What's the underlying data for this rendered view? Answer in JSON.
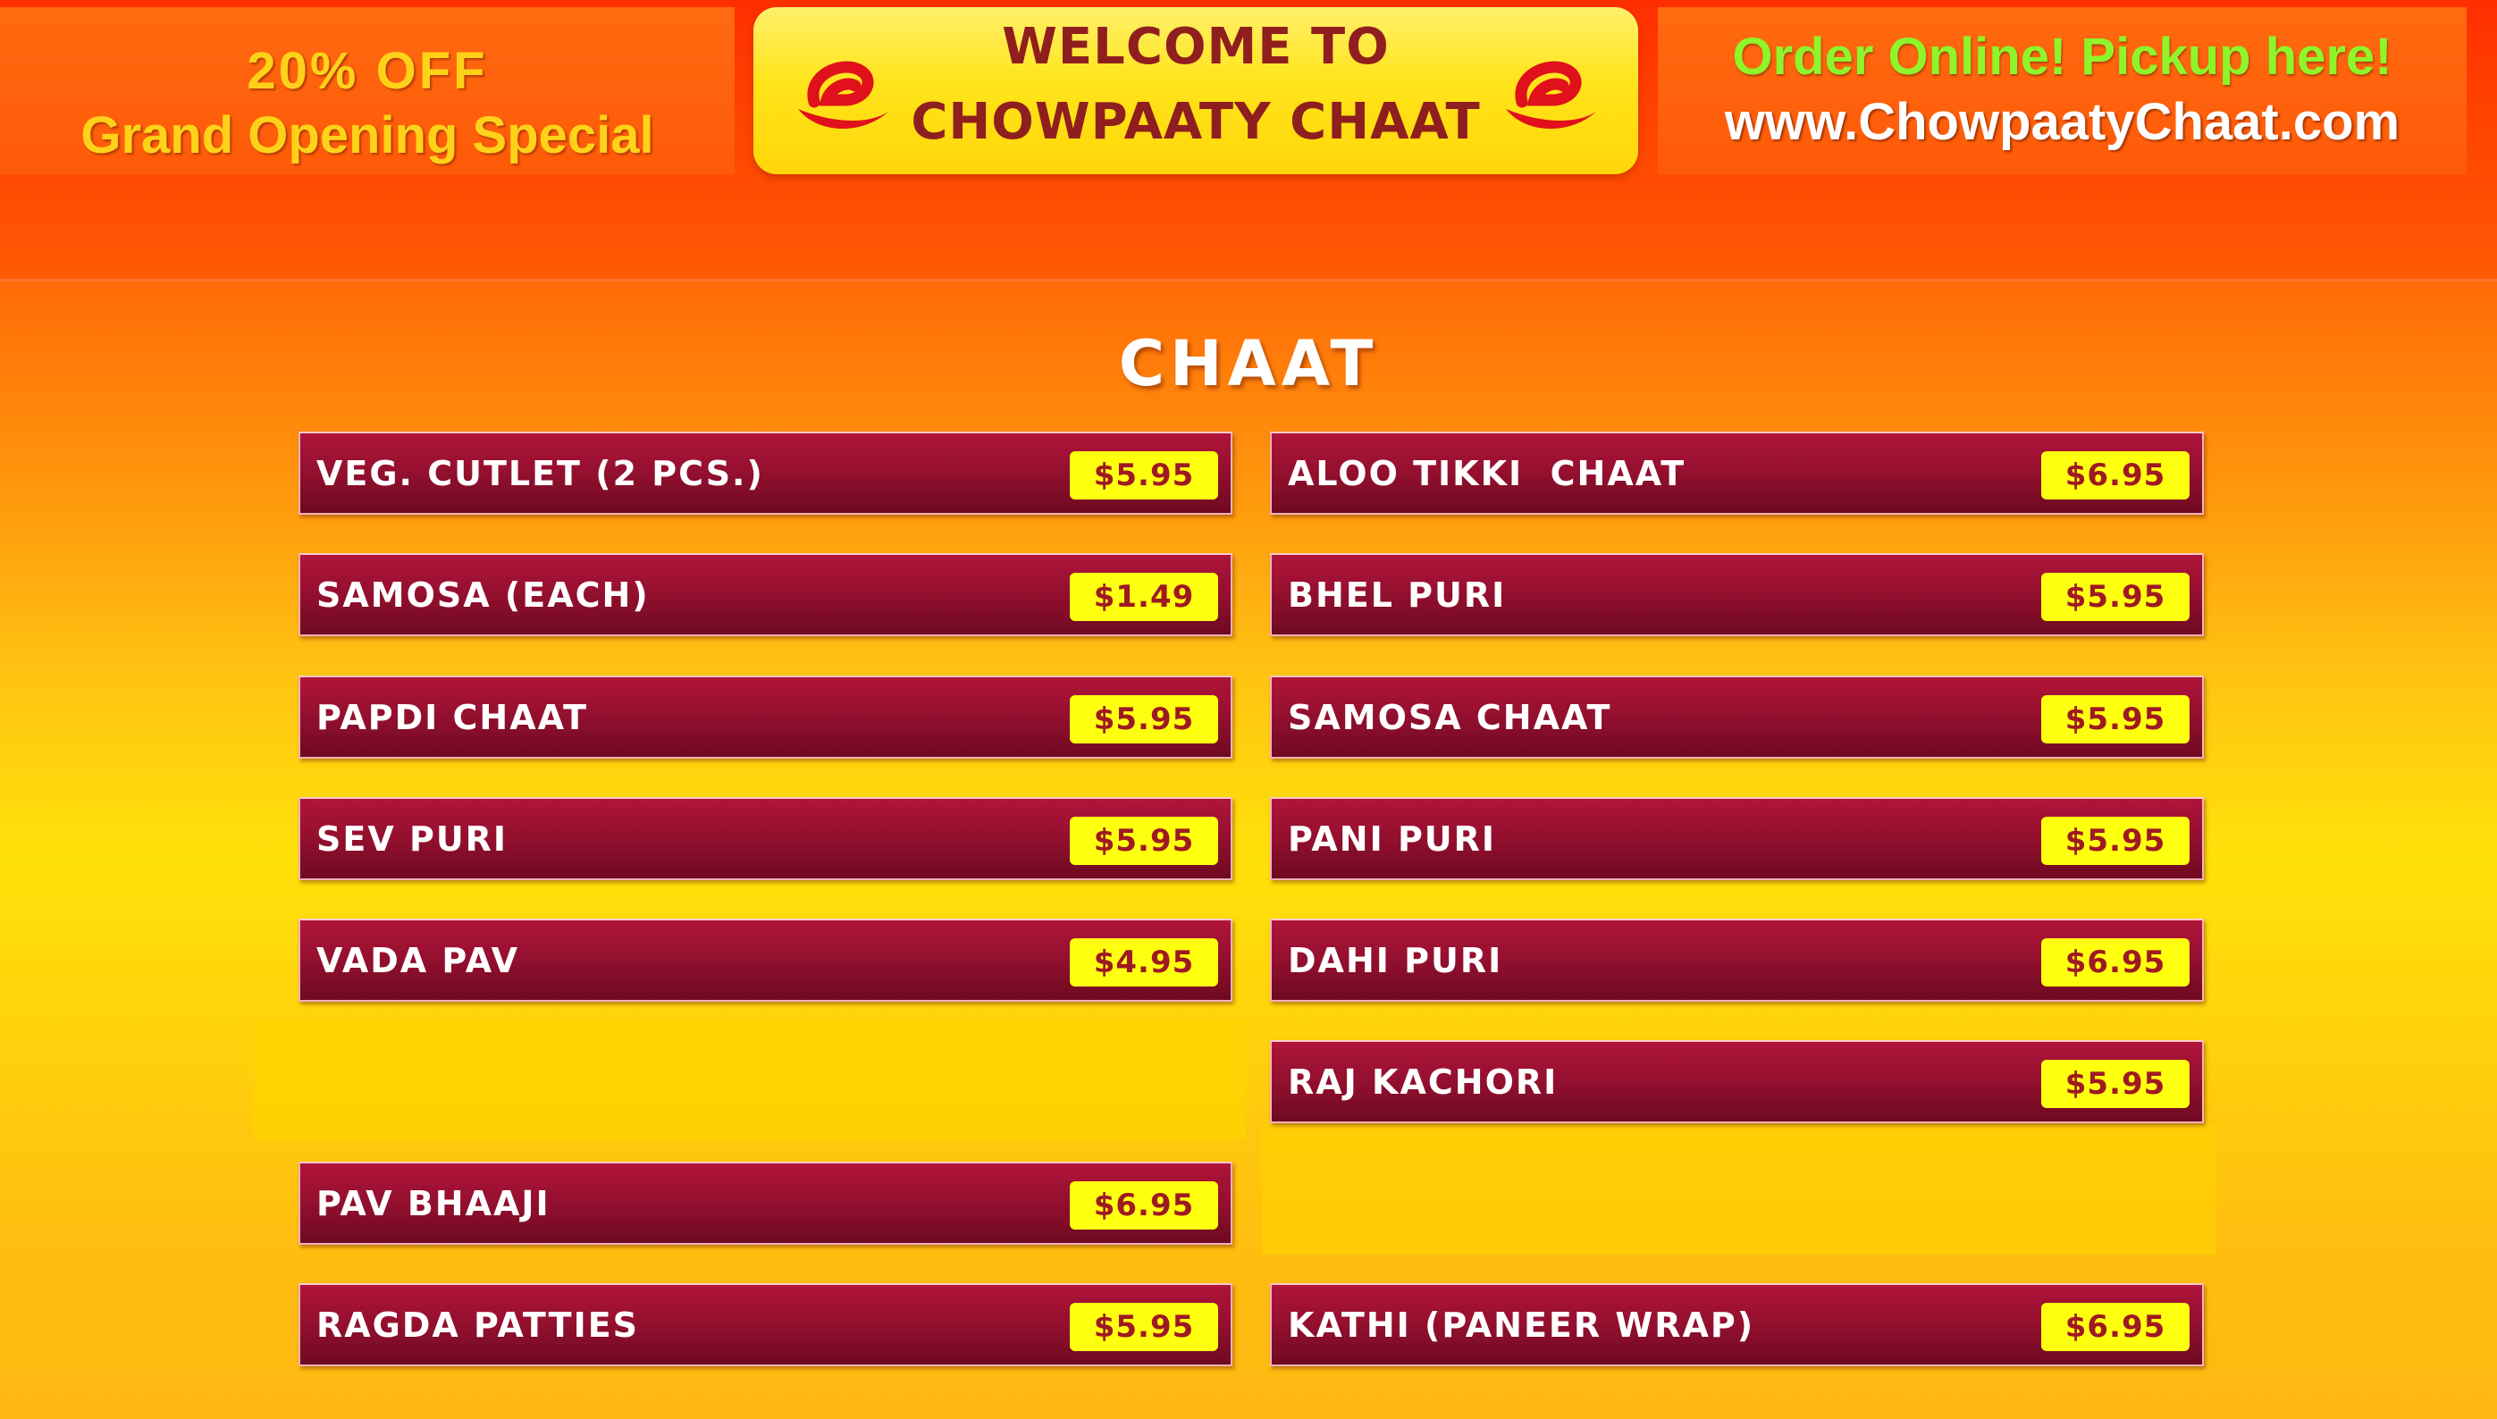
{
  "header": {
    "promo": {
      "line1": "20% OFF",
      "line2": "Grand Opening Special"
    },
    "welcome": {
      "line1": "WELCOME TO",
      "line2": "CHOWPAATY CHAAT",
      "logo_icon": "swirl-logo-icon",
      "logo_color": "#e0101c"
    },
    "order": {
      "line1": "Order Online! Pickup here!",
      "line2": "www.ChowpaatyChaat.com"
    }
  },
  "section": {
    "title": "CHAAT"
  },
  "menu": {
    "left": [
      {
        "name": "VEG. CUTLET (2 PCS.)",
        "price": "$5.95"
      },
      {
        "name": "SAMOSA (EACH)",
        "price": "$1.49"
      },
      {
        "name": "PAPDI CHAAT",
        "price": "$5.95"
      },
      {
        "name": "SEV PURI",
        "price": "$5.95"
      },
      {
        "name": "VADA PAV",
        "price": "$4.95"
      },
      {
        "name": "PAV BHAAJI",
        "price": "$6.95"
      },
      {
        "name": "RAGDA PATTIES",
        "price": "$5.95"
      }
    ],
    "right": [
      {
        "name": "ALOO TIKKI  CHAAT",
        "price": "$6.95"
      },
      {
        "name": "BHEL PURI",
        "price": "$5.95"
      },
      {
        "name": "SAMOSA CHAAT",
        "price": "$5.95"
      },
      {
        "name": "PANI PURI",
        "price": "$5.95"
      },
      {
        "name": "DAHI PURI",
        "price": "$6.95"
      },
      {
        "name": "RAJ KACHORI",
        "price": "$5.95"
      },
      {
        "name": "KATHI (PANEER WRAP)",
        "price": "$6.95"
      }
    ]
  },
  "colors": {
    "item_bg": "#961030",
    "price_bg": "#ffff10",
    "price_text": "#9e1a22",
    "title_text": "#ffffff"
  }
}
